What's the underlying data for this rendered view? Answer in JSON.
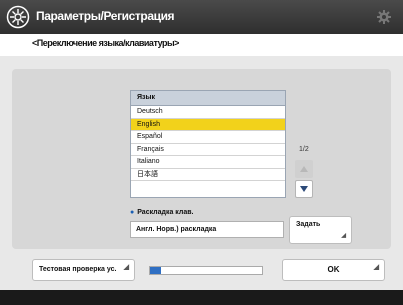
{
  "titlebar": {
    "title": "Параметры/Регистрация"
  },
  "subtitle": "<Переключение языка/клавиатуры>",
  "language_list": {
    "header": "Язык",
    "items": [
      "Deutsch",
      "English",
      "Español",
      "Français",
      "Italiano",
      "日本語"
    ],
    "selected": "English"
  },
  "pager": {
    "text": "1/2"
  },
  "layout": {
    "label": "Раскладка клав.",
    "value": "Англ. Норв.) раскладка"
  },
  "buttons": {
    "set_label": "Задать",
    "test_label": "Тестовая проверка ус.",
    "ok_label": "OK"
  },
  "progress": {
    "fraction": 0.1
  },
  "colors": {
    "selected_row": "#f2d21b",
    "accent": "#2f6fc3"
  }
}
